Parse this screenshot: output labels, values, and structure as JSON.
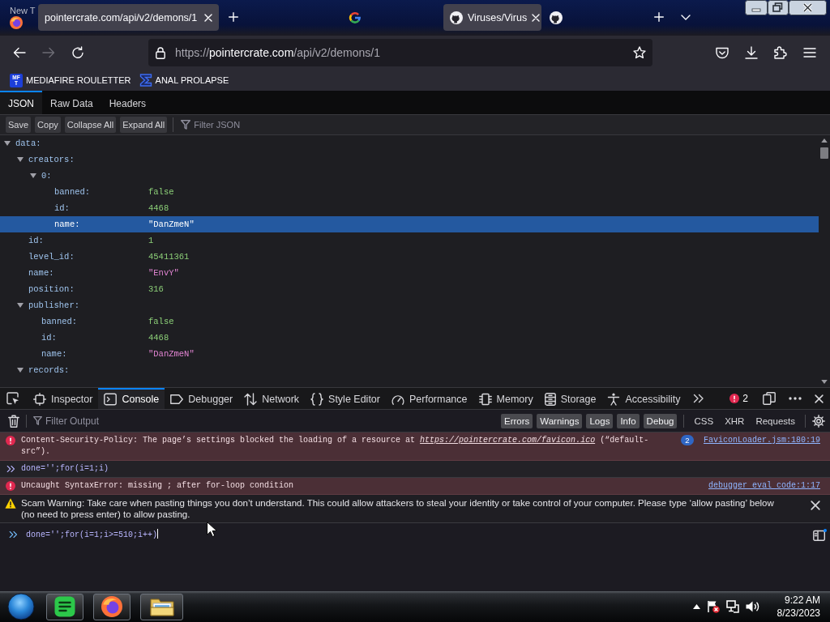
{
  "background_window": {
    "title": "New T"
  },
  "tabs": [
    {
      "kind": "page",
      "title": "pointercrate.com/api/v2/demons/1",
      "selected": true
    },
    {
      "kind": "google",
      "selected": false
    },
    {
      "kind": "github",
      "title": "Viruses/Virus",
      "selected": true
    },
    {
      "kind": "github",
      "selected": false
    }
  ],
  "nav_buttons": [
    {
      "kind": "back",
      "disabled": false
    },
    {
      "kind": "forward",
      "disabled": true
    },
    {
      "kind": "reload",
      "disabled": false
    }
  ],
  "address_bar": {
    "scheme": "https://",
    "domain": "pointercrate.com",
    "path": "/api/v2/demons/1"
  },
  "bookmarks": [
    {
      "kind": "tile",
      "tile_text": [
        "MF",
        "T"
      ],
      "label": "MEDIAFIRE ROULETTER"
    },
    {
      "kind": "sigma",
      "label": "ANAL PROLAPSE"
    }
  ],
  "json_viewer": {
    "tabs": [
      {
        "label": "JSON",
        "selected": true
      },
      {
        "label": "Raw Data",
        "selected": false
      },
      {
        "label": "Headers",
        "selected": false
      }
    ],
    "buttons": [
      "Save",
      "Copy",
      "Collapse All",
      "Expand All"
    ],
    "filter": {
      "placeholder": "Filter JSON"
    },
    "tree": [
      {
        "kind": "object",
        "key": "data:",
        "expanded": true,
        "selected": false,
        "children": [
          {
            "kind": "object",
            "key": "creators:",
            "expanded": true,
            "selected": false,
            "children": [
              {
                "kind": "object",
                "key": "0:",
                "expanded": true,
                "selected": false,
                "children": [
                  {
                    "kind": "literal",
                    "key": "banned:",
                    "value": "false",
                    "selected": false
                  },
                  {
                    "kind": "literal",
                    "key": "id:",
                    "value": "4468",
                    "selected": false
                  },
                  {
                    "kind": "string",
                    "key": "name:",
                    "value": "\"DanZmeN\"",
                    "selected": true
                  }
                ]
              }
            ]
          },
          {
            "kind": "literal",
            "key": "id:",
            "value": "1",
            "selected": false
          },
          {
            "kind": "literal",
            "key": "level_id:",
            "value": "45411361",
            "selected": false
          },
          {
            "kind": "string",
            "key": "name:",
            "value": "\"EnvY\"",
            "selected": false
          },
          {
            "kind": "literal",
            "key": "position:",
            "value": "316",
            "selected": false
          },
          {
            "kind": "object",
            "key": "publisher:",
            "expanded": true,
            "selected": false,
            "children": [
              {
                "kind": "literal",
                "key": "banned:",
                "value": "false",
                "selected": false
              },
              {
                "kind": "literal",
                "key": "id:",
                "value": "4468",
                "selected": false
              },
              {
                "kind": "string",
                "key": "name:",
                "value": "\"DanZmeN\"",
                "selected": false
              }
            ]
          },
          {
            "kind": "object",
            "key": "records:",
            "expanded": true,
            "selected": false
          }
        ]
      }
    ]
  },
  "devtools": {
    "tools": [
      {
        "kind": "inspector",
        "label": "Inspector",
        "selected": false
      },
      {
        "kind": "console",
        "label": "Console",
        "selected": true
      },
      {
        "kind": "debugger",
        "label": "Debugger",
        "selected": false
      },
      {
        "kind": "network",
        "label": "Network",
        "selected": false
      },
      {
        "kind": "style-editor",
        "label": "Style Editor",
        "selected": false
      },
      {
        "kind": "performance",
        "label": "Performance",
        "selected": false
      },
      {
        "kind": "memory",
        "label": "Memory",
        "selected": false
      },
      {
        "kind": "storage",
        "label": "Storage",
        "selected": false
      },
      {
        "kind": "accessibility",
        "label": "Accessibility",
        "selected": false
      }
    ],
    "error_count": "2",
    "filter": {
      "placeholder": "Filter Output"
    },
    "levels": [
      {
        "label": "Errors",
        "on": true
      },
      {
        "label": "Warnings",
        "on": true
      },
      {
        "label": "Logs",
        "on": true
      },
      {
        "label": "Info",
        "on": true
      },
      {
        "label": "Debug",
        "on": true
      }
    ],
    "request_filters": [
      {
        "label": "CSS",
        "on": false
      },
      {
        "label": "XHR",
        "on": false
      },
      {
        "label": "Requests",
        "on": false
      }
    ],
    "messages": [
      {
        "kind": "error",
        "text": "Content-Security-Policy: The page’s settings blocked the loading of a resource at ",
        "link": "https://pointercrate.com/favicon.ico",
        "text_after": " (“default-src”).",
        "count": "2",
        "location": "FaviconLoader.jsm:180:19"
      },
      {
        "kind": "input",
        "text": "done='';for(i=1;i)"
      },
      {
        "kind": "error",
        "text": "Uncaught SyntaxError: missing ; after for-loop condition",
        "location": "debugger eval code:1:17"
      },
      {
        "kind": "warning",
        "text": "Scam Warning: Take care when pasting things you don’t understand. This could allow attackers to steal your identity or take control of your computer. Please type ‘allow pasting’ below (no need to press enter) to allow pasting."
      }
    ],
    "prompt": {
      "value": "done='';for(i=1;i>=510;i++)"
    }
  },
  "taskbar": {
    "apps": [
      {
        "kind": "notes"
      },
      {
        "kind": "browser"
      },
      {
        "kind": "folder"
      }
    ],
    "time": "9:22 AM",
    "date": "8/23/2023"
  }
}
